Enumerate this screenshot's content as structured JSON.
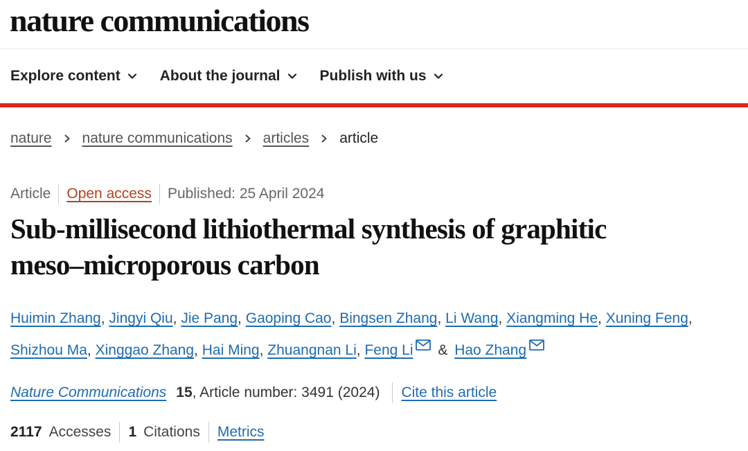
{
  "header": {
    "logo_text": "nature communications"
  },
  "nav": {
    "items": [
      {
        "label": "Explore content"
      },
      {
        "label": "About the journal"
      },
      {
        "label": "Publish with us"
      }
    ],
    "accent_color": "#e1261c"
  },
  "breadcrumb": {
    "items": [
      "nature",
      "nature communications",
      "articles"
    ],
    "current": "article"
  },
  "article": {
    "type": "Article",
    "access": "Open access",
    "published": "Published: 25 April 2024",
    "title_line1": "Sub-millisecond lithiothermal synthesis of graphitic",
    "title_line2": "meso–microporous carbon",
    "authors": [
      "Huimin Zhang",
      "Jingyi Qiu",
      "Jie Pang",
      "Gaoping Cao",
      "Bingsen Zhang",
      "Li Wang",
      "Xiangming He",
      "Xuning Feng",
      "Shizhou Ma",
      "Xinggao Zhang",
      "Hai Ming",
      "Zhuangnan Li",
      "Feng Li",
      "Hao Zhang"
    ],
    "author_separator": ",",
    "author_conjunction": "&",
    "journal": "Nature Communications",
    "volume": "15",
    "article_number": ", Article number: 3491 (2024)",
    "cite_label": "Cite this article",
    "accesses_count": "2117",
    "accesses_label": "Accesses",
    "citations_count": "1",
    "citations_label": "Citations",
    "metrics_label": "Metrics"
  },
  "icons": {
    "nav_chevron": "chevron-down-icon",
    "breadcrumb_separator": "chevron-right-icon",
    "corresponding_author": "mail-icon"
  }
}
